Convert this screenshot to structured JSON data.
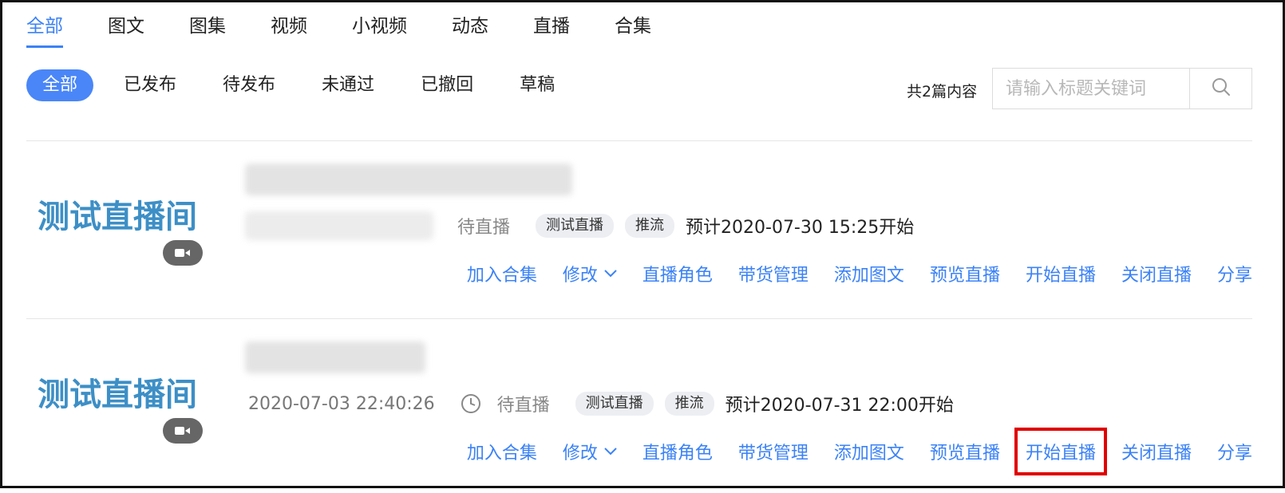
{
  "top_tabs": [
    "全部",
    "图文",
    "图集",
    "视频",
    "小视频",
    "动态",
    "直播",
    "合集"
  ],
  "filters": [
    "全部",
    "已发布",
    "待发布",
    "未通过",
    "已撤回",
    "草稿"
  ],
  "count_text": "共2篇内容",
  "search": {
    "placeholder": "请输入标题关键词",
    "value": ""
  },
  "items": [
    {
      "thumb_title": "测试直播间",
      "date": "",
      "status": "待直播",
      "tags": [
        "测试直播",
        "推流"
      ],
      "schedule": "预计2020-07-30 15:25开始",
      "actions": [
        "加入合集",
        "修改",
        "直播角色",
        "带货管理",
        "添加图文",
        "预览直播",
        "开始直播",
        "关闭直播",
        "分享"
      ]
    },
    {
      "thumb_title": "测试直播间",
      "date": "2020-07-03 22:40:26",
      "status": "待直播",
      "tags": [
        "测试直播",
        "推流"
      ],
      "schedule": "预计2020-07-31 22:00开始",
      "actions": [
        "加入合集",
        "修改",
        "直播角色",
        "带货管理",
        "添加图文",
        "预览直播",
        "开始直播",
        "关闭直播",
        "分享"
      ]
    }
  ],
  "colors": {
    "accent": "#3b82f6",
    "highlight": "#e00000",
    "thumb_text": "#3d8fc6"
  },
  "icons": {
    "search": "search-icon",
    "camera": "video-camera-icon",
    "clock": "clock-icon",
    "dropdown": "chevron-down-icon"
  }
}
